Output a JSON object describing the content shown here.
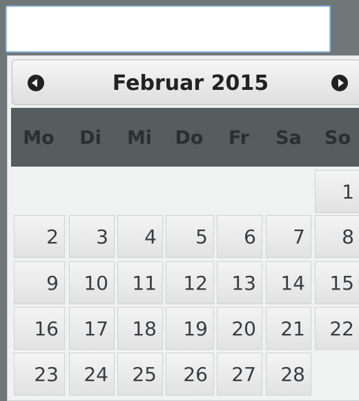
{
  "datepicker": {
    "title": "Februar 2015",
    "weekdays": [
      "Mo",
      "Di",
      "Mi",
      "Do",
      "Fr",
      "Sa",
      "So"
    ],
    "weeks": [
      [
        "",
        "",
        "",
        "",
        "",
        "",
        "1"
      ],
      [
        "2",
        "3",
        "4",
        "5",
        "6",
        "7",
        "8"
      ],
      [
        "9",
        "10",
        "11",
        "12",
        "13",
        "14",
        "15"
      ],
      [
        "16",
        "17",
        "18",
        "19",
        "20",
        "21",
        "22"
      ],
      [
        "23",
        "24",
        "25",
        "26",
        "27",
        "28",
        ""
      ]
    ],
    "prev_icon": "chevron-left-circle-icon",
    "next_icon": "chevron-right-circle-icon"
  },
  "colors": {
    "background": "#6f7779",
    "input_border": "#8fbde0",
    "weekday_header": "#555d5f",
    "cell": "#e8e8e8"
  }
}
